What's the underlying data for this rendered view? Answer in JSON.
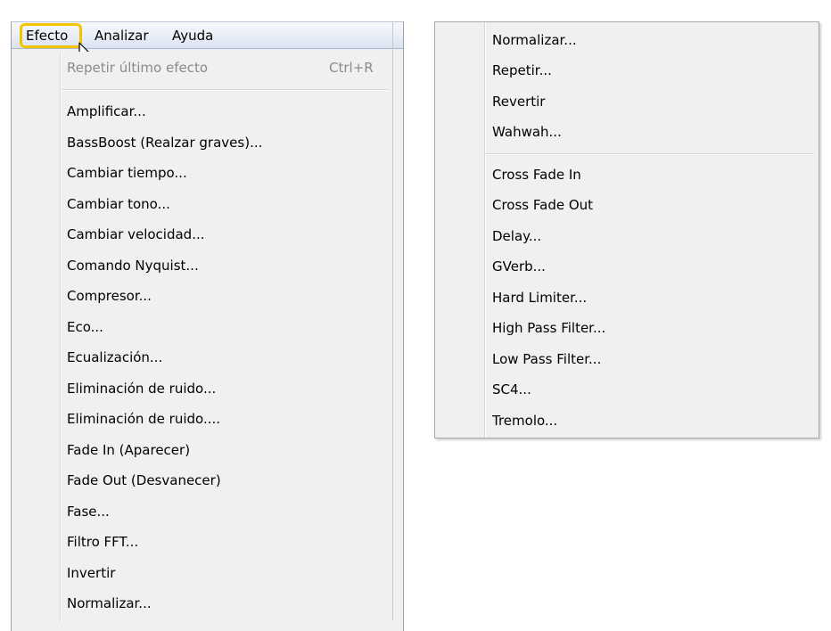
{
  "menubar": {
    "items": [
      "Efecto",
      "Analizar",
      "Ayuda"
    ]
  },
  "highlight_color": "#f5c400",
  "left_menu": {
    "repeat_last": {
      "label": "Repetir último efecto",
      "shortcut": "Ctrl+R",
      "disabled": true
    },
    "items": [
      "Amplificar...",
      "BassBoost (Realzar graves)...",
      "Cambiar tiempo...",
      "Cambiar tono...",
      "Cambiar velocidad...",
      "Comando Nyquist...",
      "Compresor...",
      "Eco...",
      "Ecualización...",
      "Eliminación de ruido...",
      "Eliminación de ruido....",
      "Fade In (Aparecer)",
      "Fade Out (Desvanecer)",
      "Fase...",
      "Filtro FFT...",
      "Invertir",
      "Normalizar..."
    ]
  },
  "right_menu": {
    "group1": [
      "Normalizar...",
      "Repetir...",
      "Revertir",
      "Wahwah..."
    ],
    "group2": [
      "Cross Fade In",
      "Cross Fade Out",
      "Delay...",
      "GVerb...",
      "Hard Limiter...",
      "High Pass Filter...",
      "Low Pass Filter...",
      "SC4...",
      "Tremolo..."
    ]
  }
}
